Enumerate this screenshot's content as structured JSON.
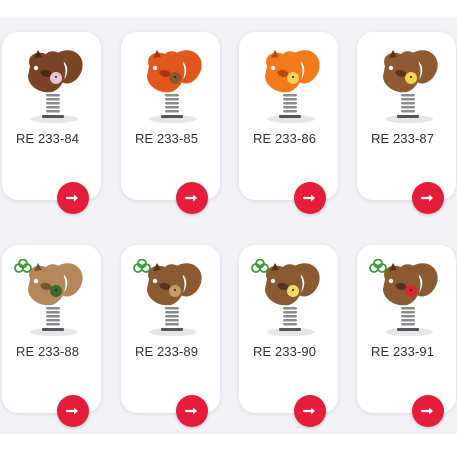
{
  "products": [
    {
      "code": "RE 233-84",
      "eco": false,
      "body_color": "#7a4526",
      "dark_color": "#4a2a14",
      "accent_color": "#e7c3d8"
    },
    {
      "code": "RE 233-85",
      "eco": false,
      "body_color": "#e2571b",
      "dark_color": "#a8350c",
      "accent_color": "#8a5a2c"
    },
    {
      "code": "RE 233-86",
      "eco": false,
      "body_color": "#f27a1a",
      "dark_color": "#b84a0a",
      "accent_color": "#f2d25a"
    },
    {
      "code": "RE 233-87",
      "eco": false,
      "body_color": "#8e5a33",
      "dark_color": "#5a3519",
      "accent_color": "#f3d44a"
    },
    {
      "code": "RE 233-88",
      "eco": true,
      "body_color": "#b4875c",
      "dark_color": "#7a5330",
      "accent_color": "#3f6a2a"
    },
    {
      "code": "RE 233-89",
      "eco": true,
      "body_color": "#8a5a32",
      "dark_color": "#56331a",
      "accent_color": "#c79a66"
    },
    {
      "code": "RE 233-90",
      "eco": true,
      "body_color": "#8a5a32",
      "dark_color": "#56331a",
      "accent_color": "#f1dc6a"
    },
    {
      "code": "RE 233-91",
      "eco": true,
      "body_color": "#8a5a32",
      "dark_color": "#56331a",
      "accent_color": "#d8262f"
    }
  ],
  "colors": {
    "button": "#e41e3a",
    "eco_badge": "#3c9a3c",
    "spring": "#8c8c8c"
  },
  "icons": {
    "arrow": "arrow-right-icon",
    "eco": "eco-leaves-icon"
  }
}
